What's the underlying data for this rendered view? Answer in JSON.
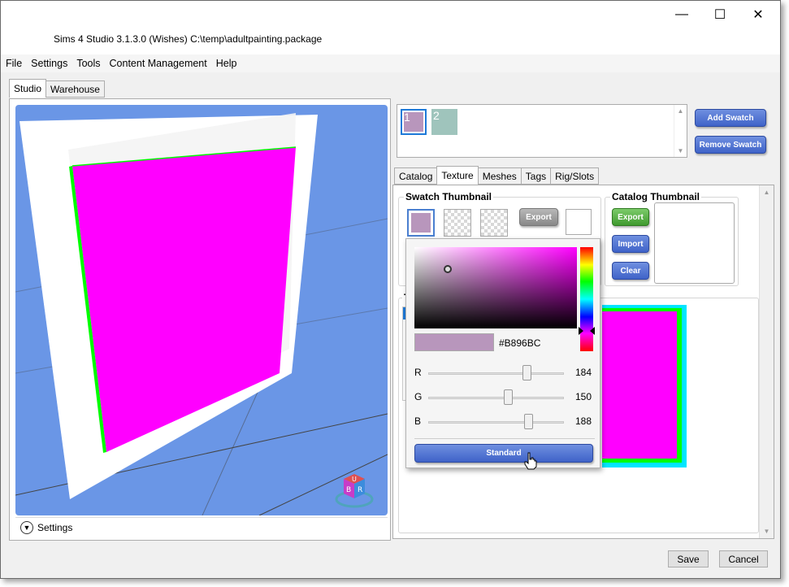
{
  "window": {
    "title": "Sims 4 Studio 3.1.3.0 (Wishes)  C:\\temp\\adultpainting.package",
    "controls": {
      "minimize": "—",
      "maximize": "☐",
      "close": "✕"
    }
  },
  "menu": [
    "File",
    "Settings",
    "Tools",
    "Content Management",
    "Help"
  ],
  "left_tabs": [
    "Studio",
    "Warehouse"
  ],
  "viewport": {
    "settings_label": "Settings",
    "cube_letters": [
      "U",
      "B",
      "R"
    ]
  },
  "swatches": {
    "items": [
      {
        "label": "1",
        "color": "#B896BC"
      },
      {
        "label": "2",
        "color": "#9FC4BC"
      }
    ],
    "add_label": "Add Swatch",
    "remove_label": "Remove Swatch"
  },
  "right_tabs": [
    "Catalog",
    "Texture",
    "Meshes",
    "Tags",
    "Rig/Slots"
  ],
  "swatch_thumbnail": {
    "title": "Swatch Thumbnail",
    "export_label": "Export"
  },
  "catalog_thumbnail": {
    "title": "Catalog Thumbnail",
    "export_label": "Export",
    "import_label": "Import",
    "clear_label": "Clear"
  },
  "texture_section": {
    "label_fragment": "T"
  },
  "color_picker": {
    "hex": "#B896BC",
    "r_label": "R",
    "r": 184,
    "g_label": "G",
    "g": 150,
    "b_label": "B",
    "b": 188,
    "standard_label": "Standard"
  },
  "footer": {
    "save_label": "Save",
    "cancel_label": "Cancel"
  },
  "colors": {
    "painting": "#FF00FF",
    "frame_edge": "#00FF00",
    "texture_outer": "#00E5FF",
    "viewport_bg": "#6A96E6"
  }
}
